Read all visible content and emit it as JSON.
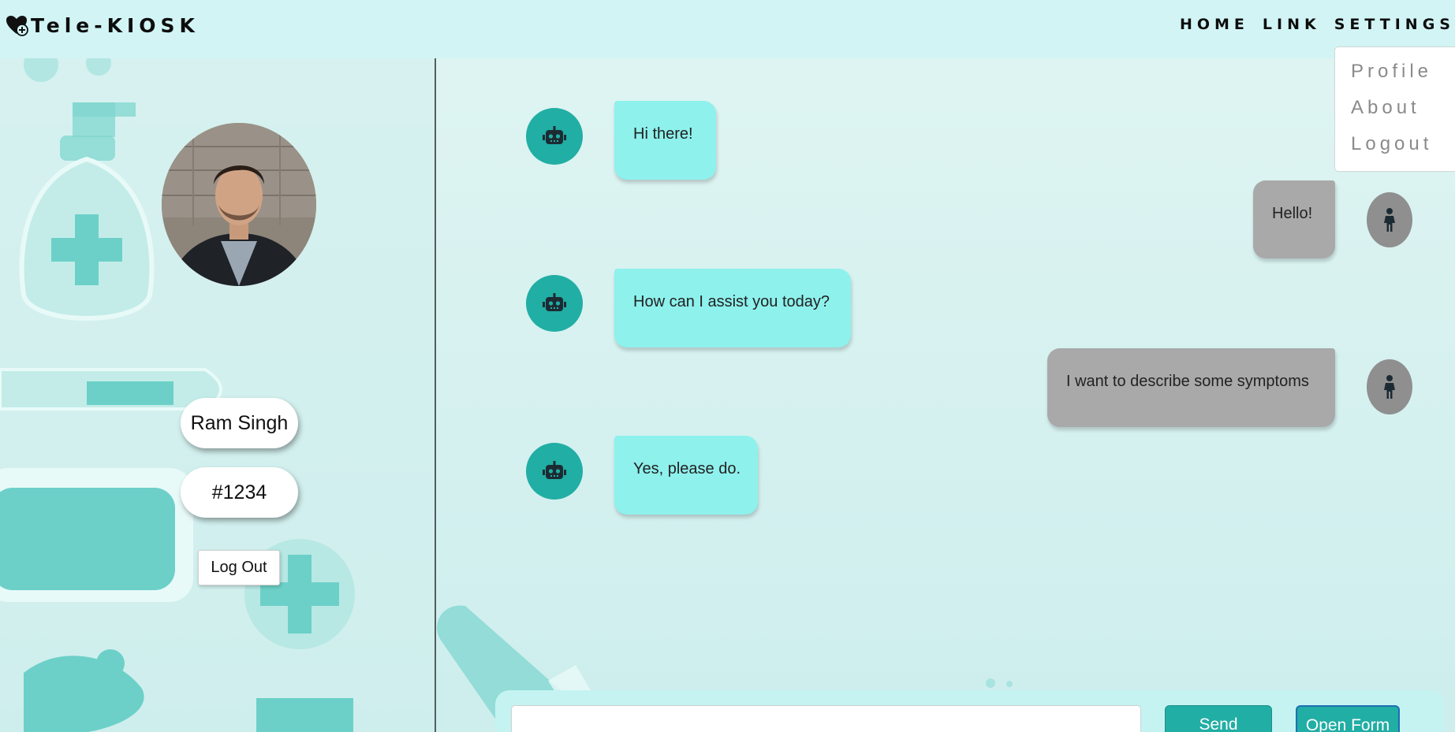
{
  "header": {
    "brand": "Tele-KIOSK",
    "nav": {
      "home": "HOME",
      "link": "LINK",
      "settings": "SETTINGS"
    },
    "settings_menu": [
      "Profile",
      "About",
      "Logout"
    ]
  },
  "profile": {
    "name": "Ram Singh",
    "id": "#1234",
    "logout_label": "Log Out"
  },
  "chat": {
    "messages": [
      {
        "sender": "bot",
        "text": "Hi there!"
      },
      {
        "sender": "user",
        "text": "Hello!"
      },
      {
        "sender": "bot",
        "text": "How can I assist you today?"
      },
      {
        "sender": "user",
        "text": "I want to describe some symptoms"
      },
      {
        "sender": "bot",
        "text": "Yes, please do."
      }
    ]
  },
  "composer": {
    "placeholder": "",
    "send_label": "Send",
    "open_form_label": "Open Form"
  },
  "icons": {
    "brand": "heart-plus-icon",
    "bot": "robot-icon",
    "user": "person-icon"
  },
  "colors": {
    "header_bg": "#d2f4f5",
    "page_bg": "#d9f1ef",
    "accent_teal": "#21aea4",
    "bot_bubble": "#8ef1ec",
    "user_bubble": "#a9a9a9",
    "user_avatar": "#8f8f8f"
  }
}
